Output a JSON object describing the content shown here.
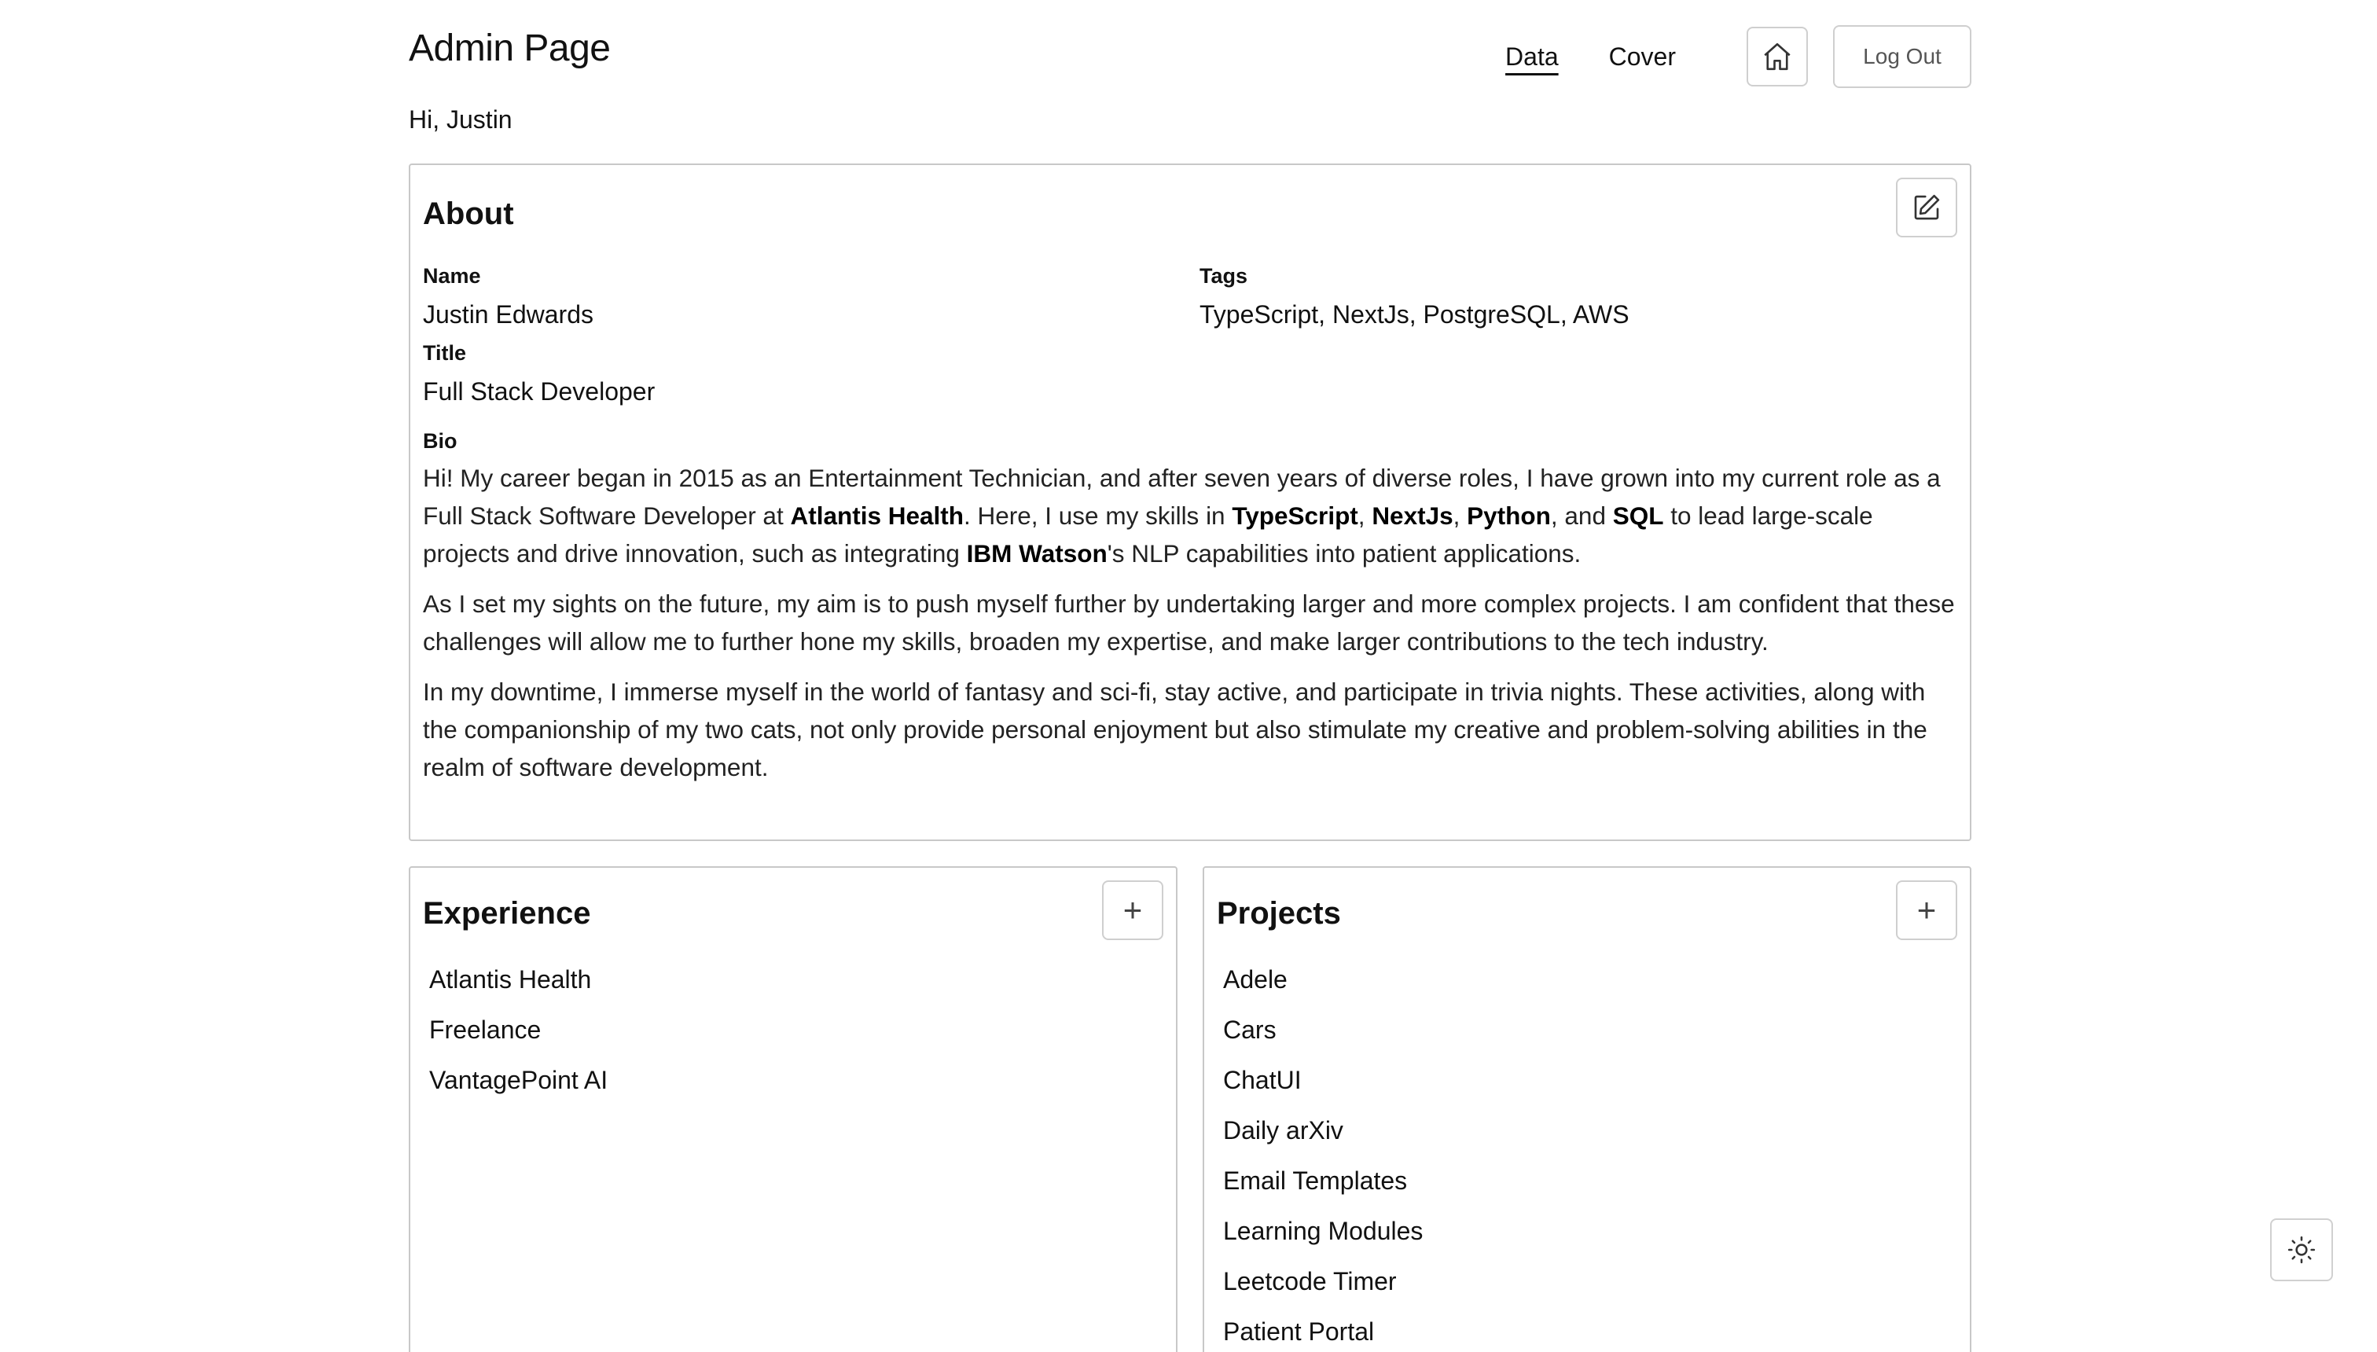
{
  "header": {
    "title": "Admin Page",
    "nav": [
      {
        "label": "Data",
        "active": true
      },
      {
        "label": "Cover",
        "active": false
      }
    ],
    "home_icon": "home-icon",
    "logout_label": "Log Out",
    "greeting": "Hi, Justin"
  },
  "about": {
    "title": "About",
    "edit_icon": "edit-icon",
    "name_label": "Name",
    "name_value": "Justin Edwards",
    "tags_label": "Tags",
    "tags_value": "TypeScript, NextJs, PostgreSQL, AWS",
    "title_label": "Title",
    "title_value": "Full Stack Developer",
    "bio_label": "Bio",
    "bio": {
      "p1_a": "Hi! My career began in 2015 as an Entertainment Technician, and after seven years of diverse roles, I have grown into my current role as a Full Stack Software Developer at ",
      "p1_b": "Atlantis Health",
      "p1_c": ". Here, I use my skills in ",
      "p1_d": "TypeScript",
      "p1_e": ", ",
      "p1_f": "NextJs",
      "p1_g": ", ",
      "p1_h": "Python",
      "p1_i": ", and ",
      "p1_j": "SQL",
      "p1_k": " to lead large-scale projects and drive innovation, such as integrating ",
      "p1_l": "IBM Watson",
      "p1_m": "'s NLP capabilities into patient applications.",
      "p2": "As I set my sights on the future, my aim is to push myself further by undertaking larger and more complex projects. I am confident that these challenges will allow me to further hone my skills, broaden my expertise, and make larger contributions to the tech industry.",
      "p3": "In my downtime, I immerse myself in the world of fantasy and sci-fi, stay active, and participate in trivia nights. These activities, along with the companionship of my two cats, not only provide personal enjoyment but also stimulate my creative and problem-solving abilities in the realm of software development."
    }
  },
  "experience": {
    "title": "Experience",
    "add_icon": "plus-icon",
    "add_symbol": "+",
    "items": [
      "Atlantis Health",
      "Freelance",
      "VantagePoint AI"
    ]
  },
  "projects": {
    "title": "Projects",
    "add_icon": "plus-icon",
    "add_symbol": "+",
    "items": [
      "Adele",
      "Cars",
      "ChatUI",
      "Daily arXiv",
      "Email Templates",
      "Learning Modules",
      "Leetcode Timer",
      "Patient Portal"
    ]
  },
  "theme_toggle_icon": "sun-icon"
}
